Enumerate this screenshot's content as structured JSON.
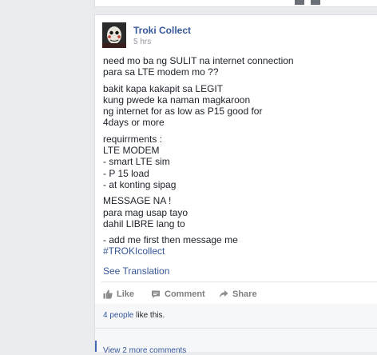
{
  "post": {
    "author": "Troki Collect",
    "time": "5 hrs",
    "paragraphs": [
      "need mo ba ng SULIT na internet connection\npara sa LTE modem mo ??",
      "bakit kapa kakapit sa LEGIT\nkung pwede ka naman magkaroon\nng internet for as low as P15 good for\n4days or more",
      "requirrments :\nLTE MODEM\n- smart LTE sim\n- P 15 load\n- at konting sipag",
      "MESSAGE NA !\npara mag usap tayo\ndahil LIBRE lang to",
      "- add me first then message me"
    ],
    "hashtag": "#TROKIcollect",
    "see_translation": "See Translation"
  },
  "actions": {
    "like": "Like",
    "comment": "Comment",
    "share": "Share"
  },
  "reactions": {
    "count_text": "4 people",
    "suffix": " like this."
  },
  "comments": {
    "view_more": "View 2 more comments"
  },
  "colors": {
    "link": "#365899",
    "text": "#1d2129",
    "muted": "#90949c",
    "background": "#e9ebee"
  }
}
